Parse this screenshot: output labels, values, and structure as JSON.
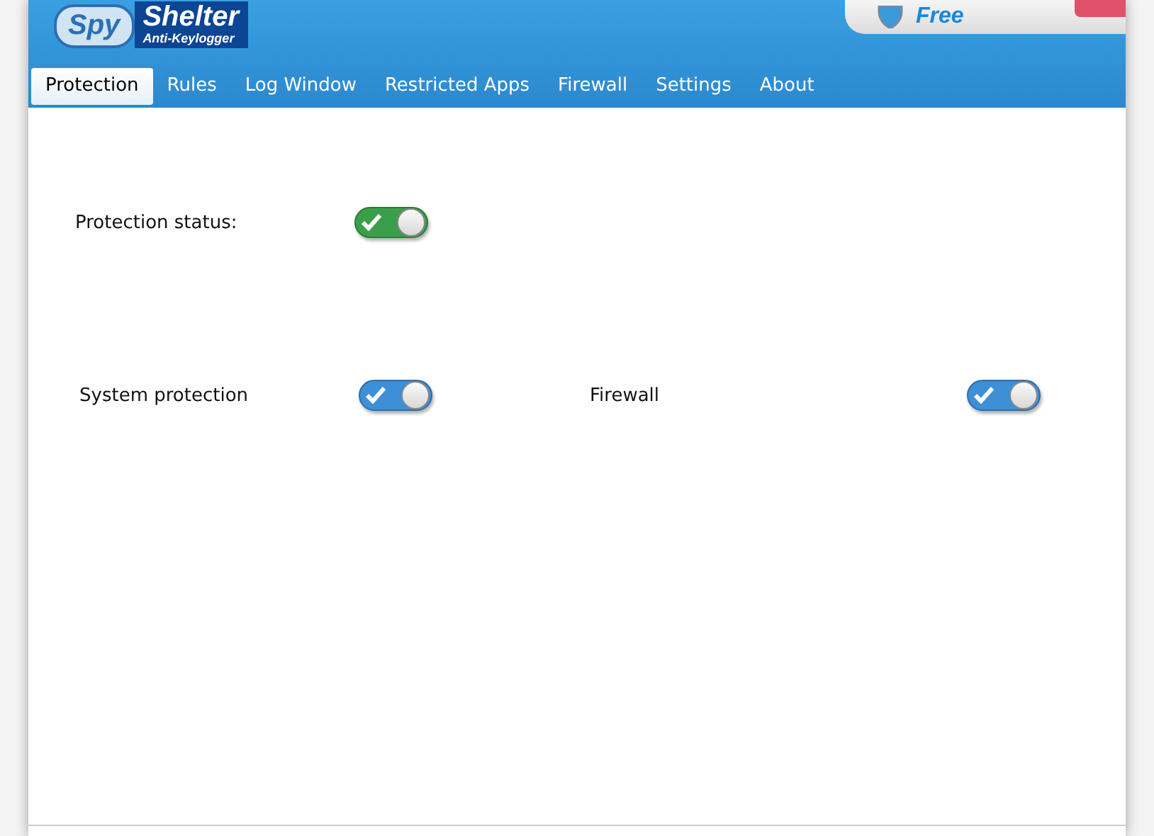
{
  "logo": {
    "left": "Spy",
    "right": "Shelter",
    "subtitle": "Anti-Keylogger"
  },
  "edition": {
    "label": "Free"
  },
  "tabs": [
    {
      "label": "Protection",
      "selected": true
    },
    {
      "label": "Rules",
      "selected": false
    },
    {
      "label": "Log Window",
      "selected": false
    },
    {
      "label": "Restricted Apps",
      "selected": false
    },
    {
      "label": "Firewall",
      "selected": false
    },
    {
      "label": "Settings",
      "selected": false
    },
    {
      "label": "About",
      "selected": false
    }
  ],
  "main_toggle": {
    "label": "Protection status:",
    "on": true
  },
  "toggles": [
    {
      "label": "System protection",
      "on": true
    },
    {
      "label": "Firewall",
      "on": true
    }
  ]
}
